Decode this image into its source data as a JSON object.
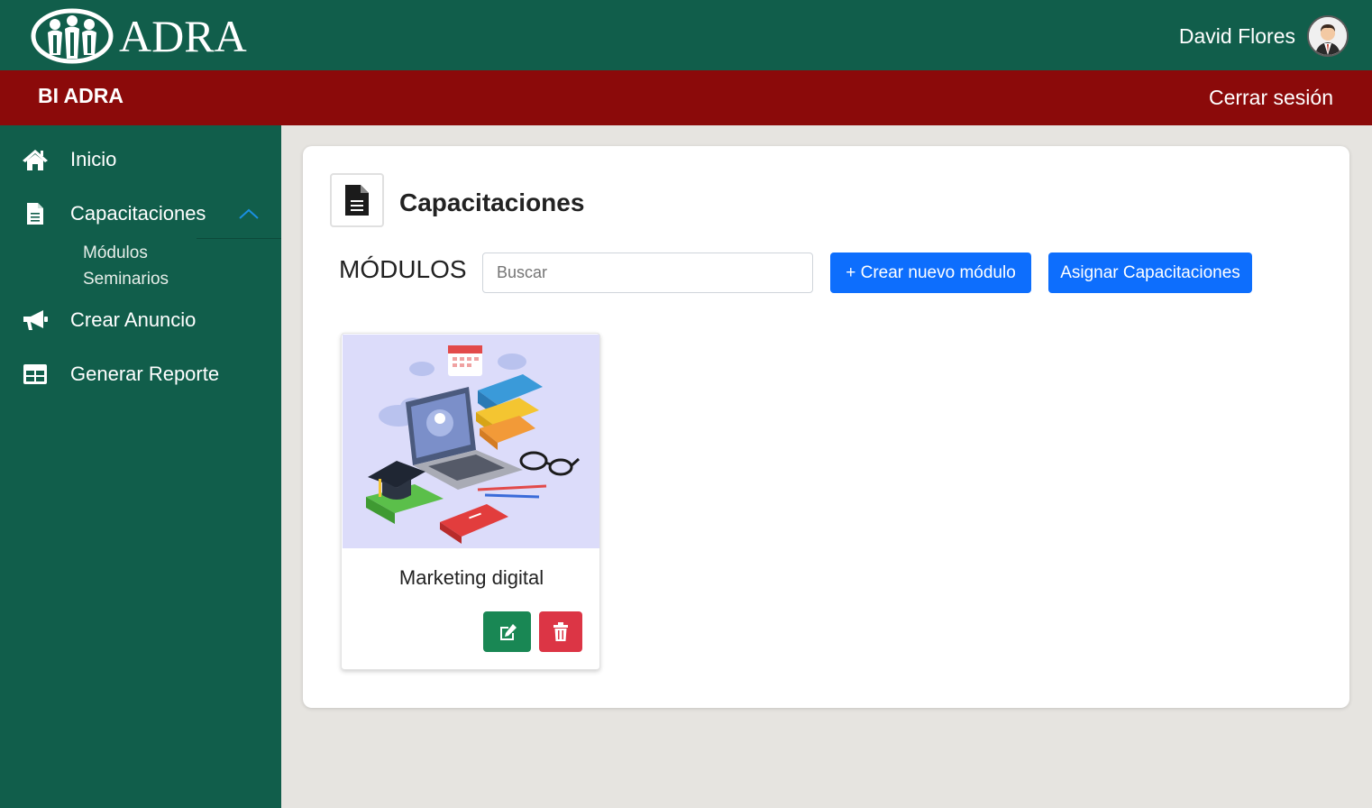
{
  "header": {
    "logo_text": "ADRA",
    "user_name": "David Flores",
    "brand_color": "#115e4b"
  },
  "subheader": {
    "brand": "BI ADRA",
    "logout_label": "Cerrar sesión",
    "color": "#8b0a0a"
  },
  "sidebar": {
    "items": [
      {
        "label": "Inicio",
        "icon": "home-icon"
      },
      {
        "label": "Capacitaciones",
        "icon": "document-icon",
        "expanded": true
      },
      {
        "label": "Crear Anuncio",
        "icon": "megaphone-icon"
      },
      {
        "label": "Generar Reporte",
        "icon": "table-icon"
      }
    ],
    "subitems": [
      {
        "label": "Módulos"
      },
      {
        "label": "Seminarios"
      }
    ]
  },
  "main": {
    "title": "Capacitaciones",
    "section_label": "MÓDULOS",
    "search_placeholder": "Buscar",
    "create_button": "+ Crear nuevo módulo",
    "assign_button": "Asignar Capacitaciones",
    "accent": "#0d6efd"
  },
  "modules": [
    {
      "title": "Marketing digital",
      "image": "online-education-illustration",
      "edit_icon": "edit-icon",
      "delete_icon": "trash-icon",
      "edit_color": "#198754",
      "delete_color": "#dc3545"
    }
  ]
}
